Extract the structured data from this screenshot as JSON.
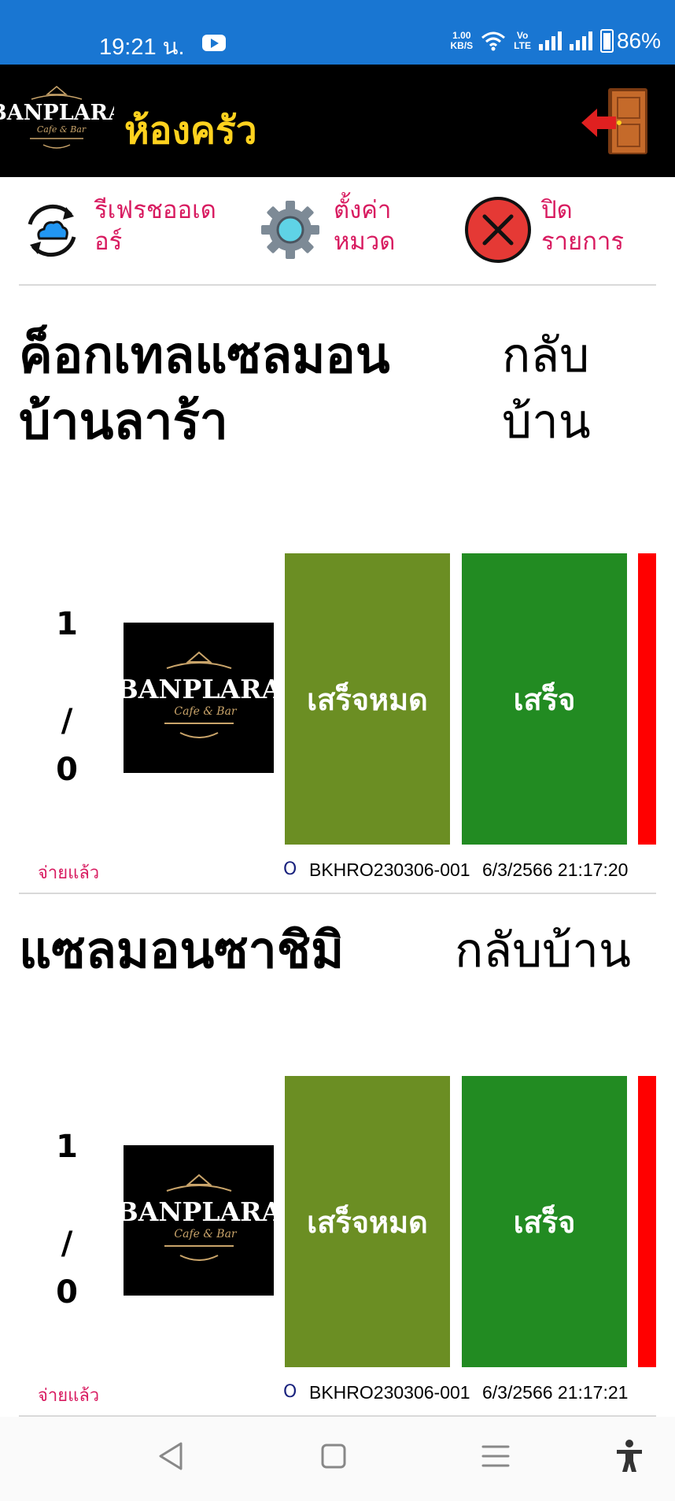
{
  "status_bar": {
    "time": "19:21 น.",
    "net_speed_value": "1.00",
    "net_speed_unit": "KB/S",
    "volte_line1": "Vo",
    "volte_line2": "LTE",
    "battery": "86%"
  },
  "app_bar": {
    "logo_text": "BANPLARA",
    "logo_sub": "Cafe & Bar",
    "title": "ห้องครัว",
    "exit_icon": "exit-door-icon"
  },
  "toolbar": {
    "refresh_label": "รีเฟรชออเดอร์",
    "settings_label": "ตั้งค่าหมวด",
    "close_label": "ปิดรายการ"
  },
  "orders": [
    {
      "name": "ค็อกเทลแซลมอนบ้านลาร้า",
      "note": "กลับบ้าน",
      "qty_done": "1",
      "qty_sep": "/",
      "qty_total": "0",
      "finish_all_label": "เสร็จหมด",
      "finish_label": "เสร็จ",
      "paid_label": "จ่ายแล้ว",
      "order_mark": "O",
      "order_id": "BKHRO230306-001",
      "order_time": "6/3/2566 21:17:20"
    },
    {
      "name": "แซลมอนซาชิมิ",
      "note": "กลับบ้าน",
      "qty_done": "1",
      "qty_sep": "/",
      "qty_total": "0",
      "finish_all_label": "เสร็จหมด",
      "finish_label": "เสร็จ",
      "paid_label": "จ่ายแล้ว",
      "order_mark": "O",
      "order_id": "BKHRO230306-001",
      "order_time": "6/3/2566 21:17:21"
    }
  ],
  "colors": {
    "status_bar": "#1976d2",
    "app_bar": "#000000",
    "title": "#ffd21e",
    "accent_label": "#d81b60",
    "finish_all": "#6b8e23",
    "finish": "#228b22",
    "cancel": "#ff0000"
  }
}
